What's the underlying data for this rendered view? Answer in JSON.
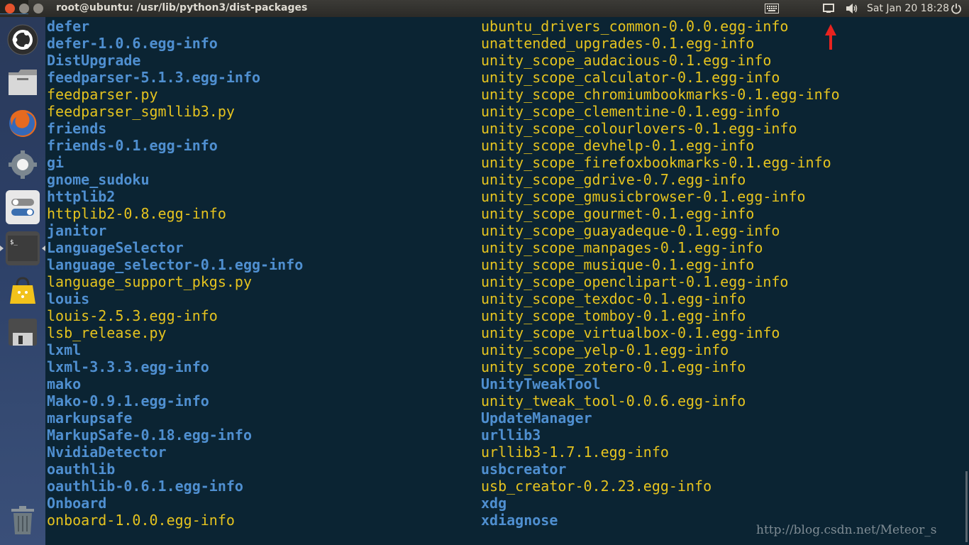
{
  "panel": {
    "window_title": "root@ubuntu: /usr/lib/python3/dist-packages",
    "clock": "Sat Jan 20 18:28",
    "icons": [
      "keyboard-icon",
      "messaging-icon",
      "volume-icon",
      "power-icon"
    ]
  },
  "launcher": {
    "items": [
      "ubuntu-dash",
      "files",
      "firefox",
      "system-settings",
      "unity-tweak-tool",
      "terminal",
      "software-center",
      "disk",
      "trash"
    ]
  },
  "terminal": {
    "left_column": [
      {
        "name": "defer",
        "type": "dir"
      },
      {
        "name": "defer-1.0.6.egg-info",
        "type": "dir"
      },
      {
        "name": "DistUpgrade",
        "type": "dir"
      },
      {
        "name": "feedparser-5.1.3.egg-info",
        "type": "dir"
      },
      {
        "name": "feedparser.py",
        "type": "file"
      },
      {
        "name": "feedparser_sgmllib3.py",
        "type": "file"
      },
      {
        "name": "friends",
        "type": "dir"
      },
      {
        "name": "friends-0.1.egg-info",
        "type": "dir"
      },
      {
        "name": "gi",
        "type": "dir"
      },
      {
        "name": "gnome_sudoku",
        "type": "dir"
      },
      {
        "name": "httplib2",
        "type": "dir"
      },
      {
        "name": "httplib2-0.8.egg-info",
        "type": "file"
      },
      {
        "name": "janitor",
        "type": "dir"
      },
      {
        "name": "LanguageSelector",
        "type": "dir"
      },
      {
        "name": "language_selector-0.1.egg-info",
        "type": "dir"
      },
      {
        "name": "language_support_pkgs.py",
        "type": "file"
      },
      {
        "name": "louis",
        "type": "dir"
      },
      {
        "name": "louis-2.5.3.egg-info",
        "type": "file"
      },
      {
        "name": "lsb_release.py",
        "type": "file"
      },
      {
        "name": "lxml",
        "type": "dir"
      },
      {
        "name": "lxml-3.3.3.egg-info",
        "type": "dir"
      },
      {
        "name": "mako",
        "type": "dir"
      },
      {
        "name": "Mako-0.9.1.egg-info",
        "type": "dir"
      },
      {
        "name": "markupsafe",
        "type": "dir"
      },
      {
        "name": "MarkupSafe-0.18.egg-info",
        "type": "dir"
      },
      {
        "name": "NvidiaDetector",
        "type": "dir"
      },
      {
        "name": "oauthlib",
        "type": "dir"
      },
      {
        "name": "oauthlib-0.6.1.egg-info",
        "type": "dir"
      },
      {
        "name": "Onboard",
        "type": "dir"
      },
      {
        "name": "onboard-1.0.0.egg-info",
        "type": "file"
      }
    ],
    "right_column": [
      {
        "name": "ubuntu_drivers_common-0.0.0.egg-info",
        "type": "file"
      },
      {
        "name": "unattended_upgrades-0.1.egg-info",
        "type": "file"
      },
      {
        "name": "unity_scope_audacious-0.1.egg-info",
        "type": "file"
      },
      {
        "name": "unity_scope_calculator-0.1.egg-info",
        "type": "file"
      },
      {
        "name": "unity_scope_chromiumbookmarks-0.1.egg-info",
        "type": "file"
      },
      {
        "name": "unity_scope_clementine-0.1.egg-info",
        "type": "file"
      },
      {
        "name": "unity_scope_colourlovers-0.1.egg-info",
        "type": "file"
      },
      {
        "name": "unity_scope_devhelp-0.1.egg-info",
        "type": "file"
      },
      {
        "name": "unity_scope_firefoxbookmarks-0.1.egg-info",
        "type": "file"
      },
      {
        "name": "unity_scope_gdrive-0.7.egg-info",
        "type": "file"
      },
      {
        "name": "unity_scope_gmusicbrowser-0.1.egg-info",
        "type": "file"
      },
      {
        "name": "unity_scope_gourmet-0.1.egg-info",
        "type": "file"
      },
      {
        "name": "unity_scope_guayadeque-0.1.egg-info",
        "type": "file"
      },
      {
        "name": "unity_scope_manpages-0.1.egg-info",
        "type": "file"
      },
      {
        "name": "unity_scope_musique-0.1.egg-info",
        "type": "file"
      },
      {
        "name": "unity_scope_openclipart-0.1.egg-info",
        "type": "file"
      },
      {
        "name": "unity_scope_texdoc-0.1.egg-info",
        "type": "file"
      },
      {
        "name": "unity_scope_tomboy-0.1.egg-info",
        "type": "file"
      },
      {
        "name": "unity_scope_virtualbox-0.1.egg-info",
        "type": "file"
      },
      {
        "name": "unity_scope_yelp-0.1.egg-info",
        "type": "file"
      },
      {
        "name": "unity_scope_zotero-0.1.egg-info",
        "type": "file"
      },
      {
        "name": "UnityTweakTool",
        "type": "dir"
      },
      {
        "name": "unity_tweak_tool-0.0.6.egg-info",
        "type": "file"
      },
      {
        "name": "UpdateManager",
        "type": "dir"
      },
      {
        "name": "urllib3",
        "type": "dir"
      },
      {
        "name": "urllib3-1.7.1.egg-info",
        "type": "file"
      },
      {
        "name": "usbcreator",
        "type": "dir"
      },
      {
        "name": "usb_creator-0.2.23.egg-info",
        "type": "file"
      },
      {
        "name": "xdg",
        "type": "dir"
      },
      {
        "name": "xdiagnose",
        "type": "dir"
      }
    ],
    "colors": {
      "dir": "#4f8fd0",
      "file": "#e5c31f",
      "background": "#0b2433"
    }
  },
  "watermark": "http://blog.csdn.net/Meteor_s",
  "annotation": {
    "arrow_color": "#e8231f"
  }
}
